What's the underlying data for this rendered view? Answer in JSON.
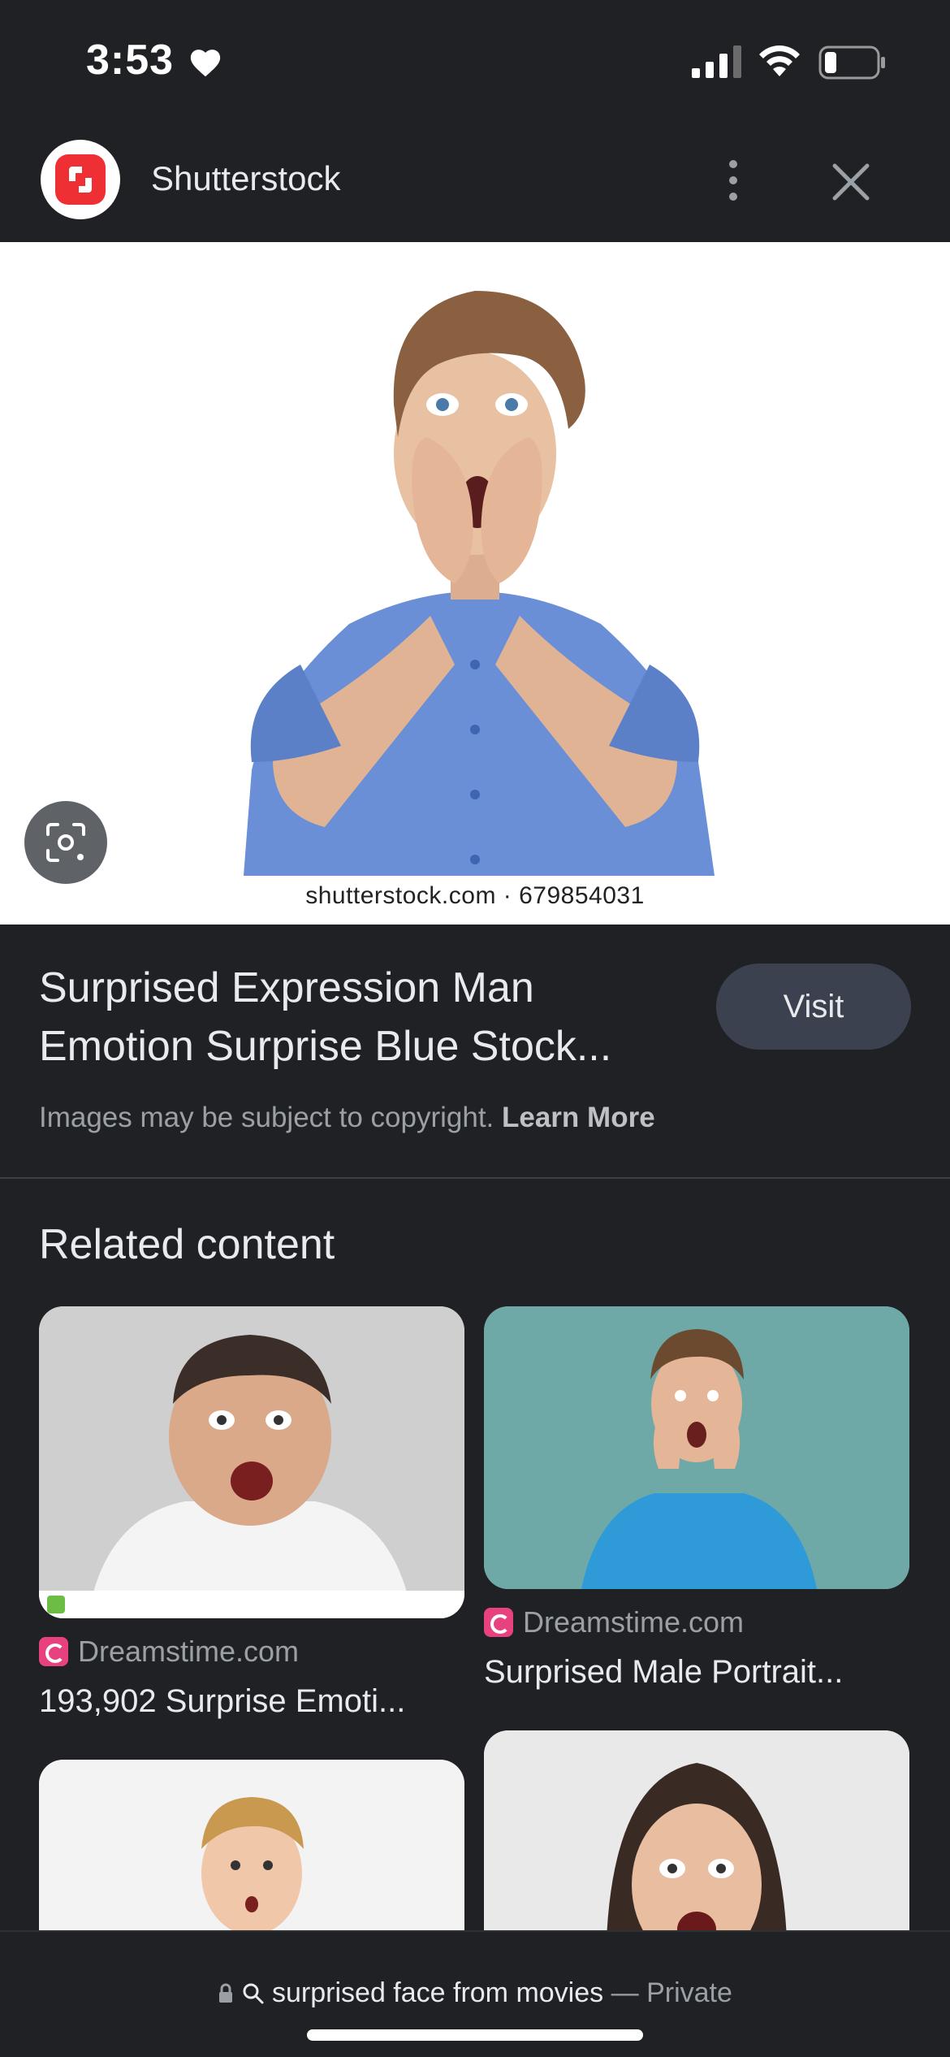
{
  "status": {
    "time": "3:53"
  },
  "header": {
    "site_name": "Shutterstock"
  },
  "preview": {
    "watermark": "shutterstock.com · 679854031"
  },
  "result": {
    "title_line1": "Surprised Expression Man",
    "title_line2": "Emotion Surprise Blue Stock...",
    "visit_label": "Visit",
    "copyright_text": "Images may be subject to copyright. ",
    "learn_more": "Learn More"
  },
  "related": {
    "heading": "Related content",
    "items": [
      {
        "source": "Dreamstime.com",
        "caption": "193,902 Surprise Emoti..."
      },
      {
        "source": "Dreamstime.com",
        "caption": "Surprised Male Portrait..."
      }
    ]
  },
  "bottom": {
    "query": "surprised face from movies",
    "separator": " — ",
    "mode": "Private"
  },
  "colors": {
    "background": "#202124",
    "visit_button": "#3c4150",
    "shutterstock_red": "#ee2f34",
    "dreamstime_pink": "#e8417f"
  },
  "icons": [
    "heart-icon",
    "signal-icon",
    "wifi-icon",
    "battery-icon",
    "more-vert-icon",
    "close-icon",
    "lens-icon",
    "lock-icon",
    "search-icon"
  ]
}
